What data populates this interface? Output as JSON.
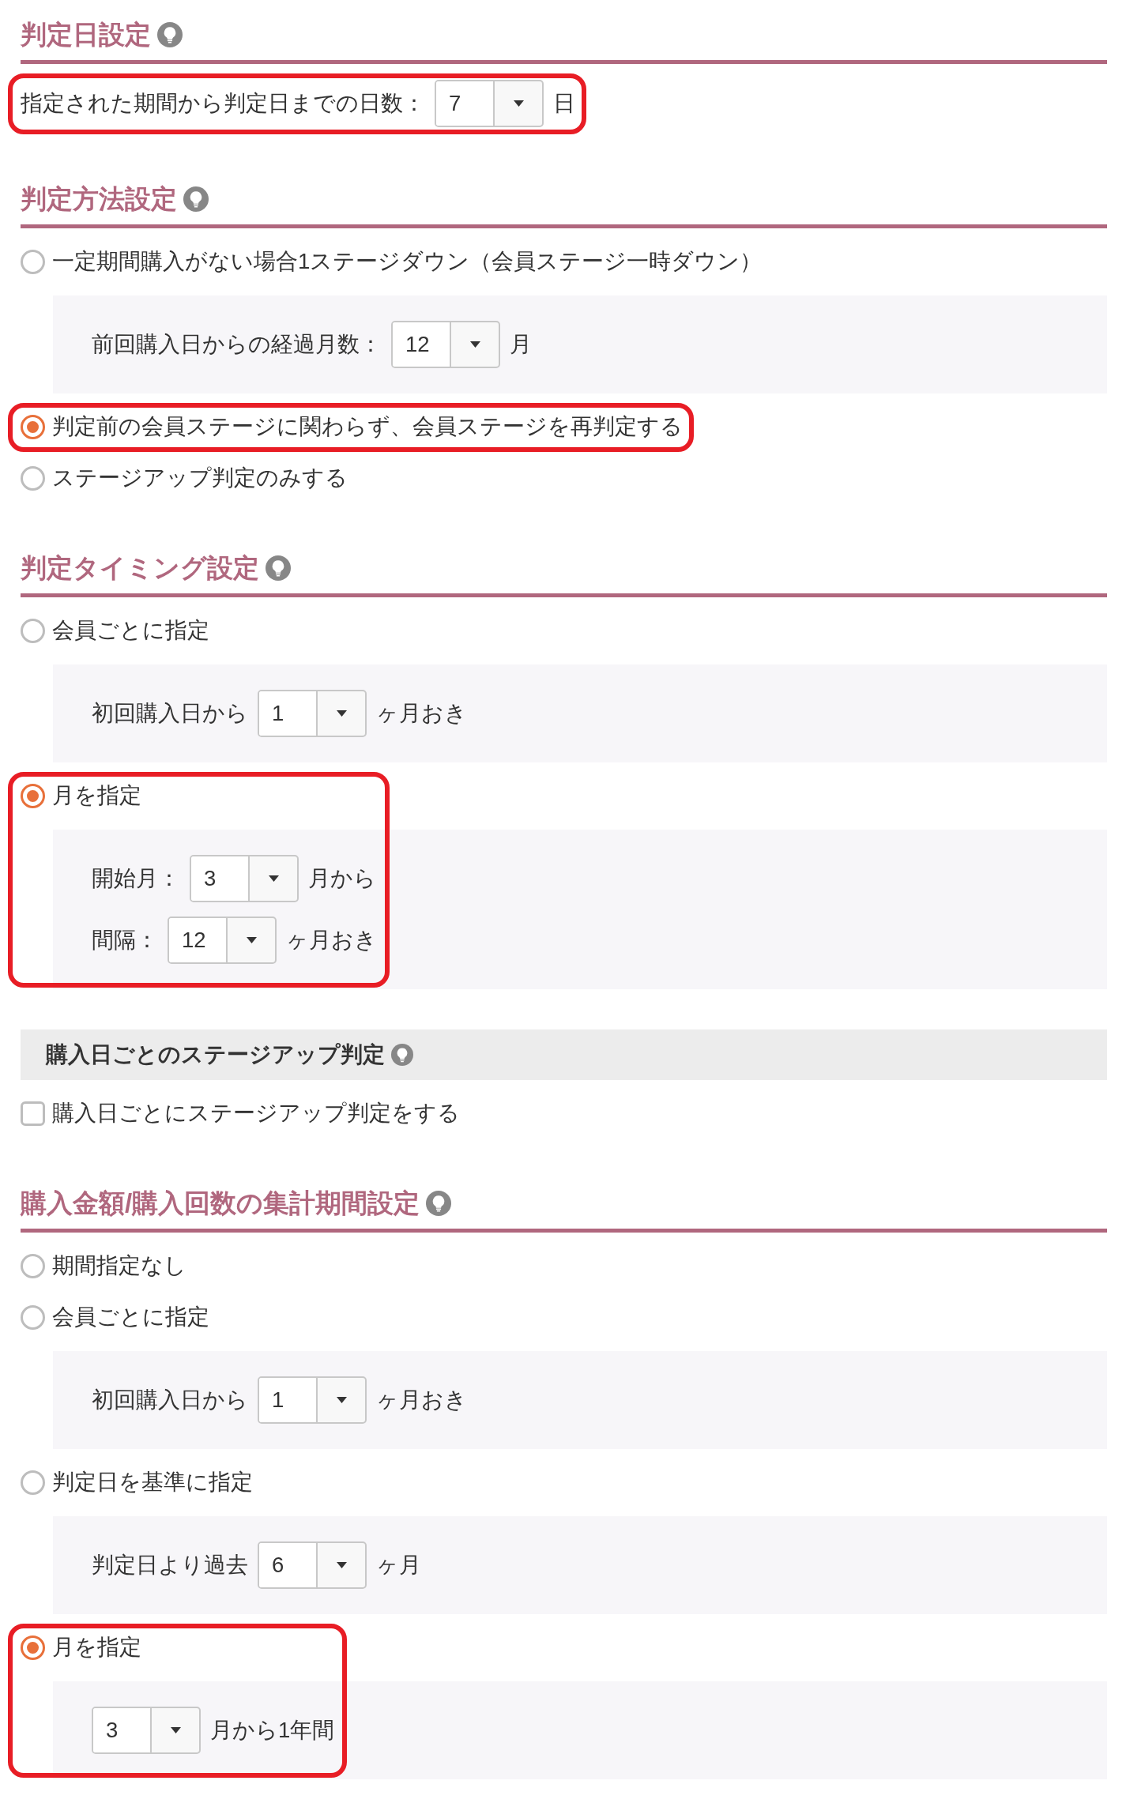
{
  "sections": [
    {
      "kind": "heading",
      "title": "判定日設定",
      "items": [
        {
          "kind": "field",
          "label": "指定された期間から判定日までの日数：",
          "value": "7",
          "unit": "日",
          "highlighted": true
        }
      ]
    },
    {
      "kind": "heading",
      "title": "判定方法設定",
      "items": [
        {
          "kind": "radio",
          "label": "一定期間購入がない場合1ステージダウン（会員ステージ一時ダウン）",
          "selected": false,
          "highlighted": false,
          "panel": [
            {
              "label": "前回購入日からの経過月数：",
              "value": "12",
              "unit": "月"
            }
          ]
        },
        {
          "kind": "radio",
          "label": "判定前の会員ステージに関わらず、会員ステージを再判定する",
          "selected": true,
          "highlighted": true
        },
        {
          "kind": "radio",
          "label": "ステージアップ判定のみする",
          "selected": false,
          "highlighted": false
        }
      ]
    },
    {
      "kind": "heading",
      "title": "判定タイミング設定",
      "items": [
        {
          "kind": "radio",
          "label": "会員ごとに指定",
          "selected": false,
          "highlighted": false,
          "panel": [
            {
              "label": "初回購入日から",
              "value": "1",
              "unit": "ヶ月おき"
            }
          ]
        },
        {
          "kind": "radio",
          "label": "月を指定",
          "selected": true,
          "highlighted": true,
          "panel": [
            {
              "label": "開始月：",
              "value": "3",
              "unit": "月から"
            },
            {
              "label": "間隔：",
              "value": "12",
              "unit": "ヶ月おき"
            }
          ]
        }
      ]
    },
    {
      "kind": "bar",
      "title": "購入日ごとのステージアップ判定",
      "items": [
        {
          "kind": "checkbox",
          "label": "購入日ごとにステージアップ判定をする",
          "checked": false
        }
      ]
    },
    {
      "kind": "heading",
      "title": "購入金額/購入回数の集計期間設定",
      "items": [
        {
          "kind": "radio",
          "label": "期間指定なし",
          "selected": false,
          "highlighted": false
        },
        {
          "kind": "radio",
          "label": "会員ごとに指定",
          "selected": false,
          "highlighted": false,
          "panel": [
            {
              "label": "初回購入日から",
              "value": "1",
              "unit": "ヶ月おき"
            }
          ]
        },
        {
          "kind": "radio",
          "label": "判定日を基準に指定",
          "selected": false,
          "highlighted": false,
          "panel": [
            {
              "label": "判定日より過去",
              "value": "6",
              "unit": "ヶ月"
            }
          ]
        },
        {
          "kind": "radio",
          "label": "月を指定",
          "selected": true,
          "highlighted": true,
          "panel": [
            {
              "value": "3",
              "unit": "月から1年間"
            }
          ]
        }
      ]
    }
  ]
}
